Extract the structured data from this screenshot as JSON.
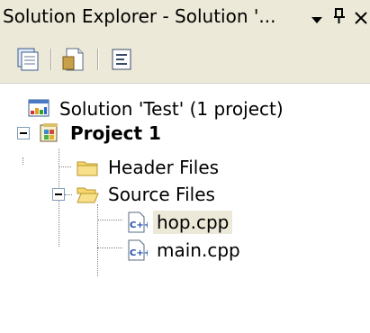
{
  "window": {
    "title": "Solution Explorer - Solution '...",
    "dropdown_glyph": "▾",
    "pin_glyph": "ᵽ",
    "close_glyph": "✕"
  },
  "toolbar": {
    "items": [
      "properties-icon",
      "show-all-files-icon",
      "view-code-icon"
    ]
  },
  "tree": {
    "solution": {
      "label": "Solution 'Test' (1 project)",
      "icon": "solution-icon"
    },
    "project": {
      "label": "Project 1",
      "icon": "project-icon",
      "expanded": true
    },
    "header_files": {
      "label": "Header Files",
      "icon": "folder-closed-icon"
    },
    "source_files": {
      "label": "Source Files",
      "icon": "folder-open-icon",
      "expanded": true
    },
    "files": [
      {
        "label": "hop.cpp",
        "icon": "cpp-file-icon",
        "selected": true
      },
      {
        "label": "main.cpp",
        "icon": "cpp-file-icon",
        "selected": false
      }
    ]
  },
  "colors": {
    "chrome": "#ece9d8",
    "selection": "#ece9d8",
    "folder": "#f5d76e"
  }
}
